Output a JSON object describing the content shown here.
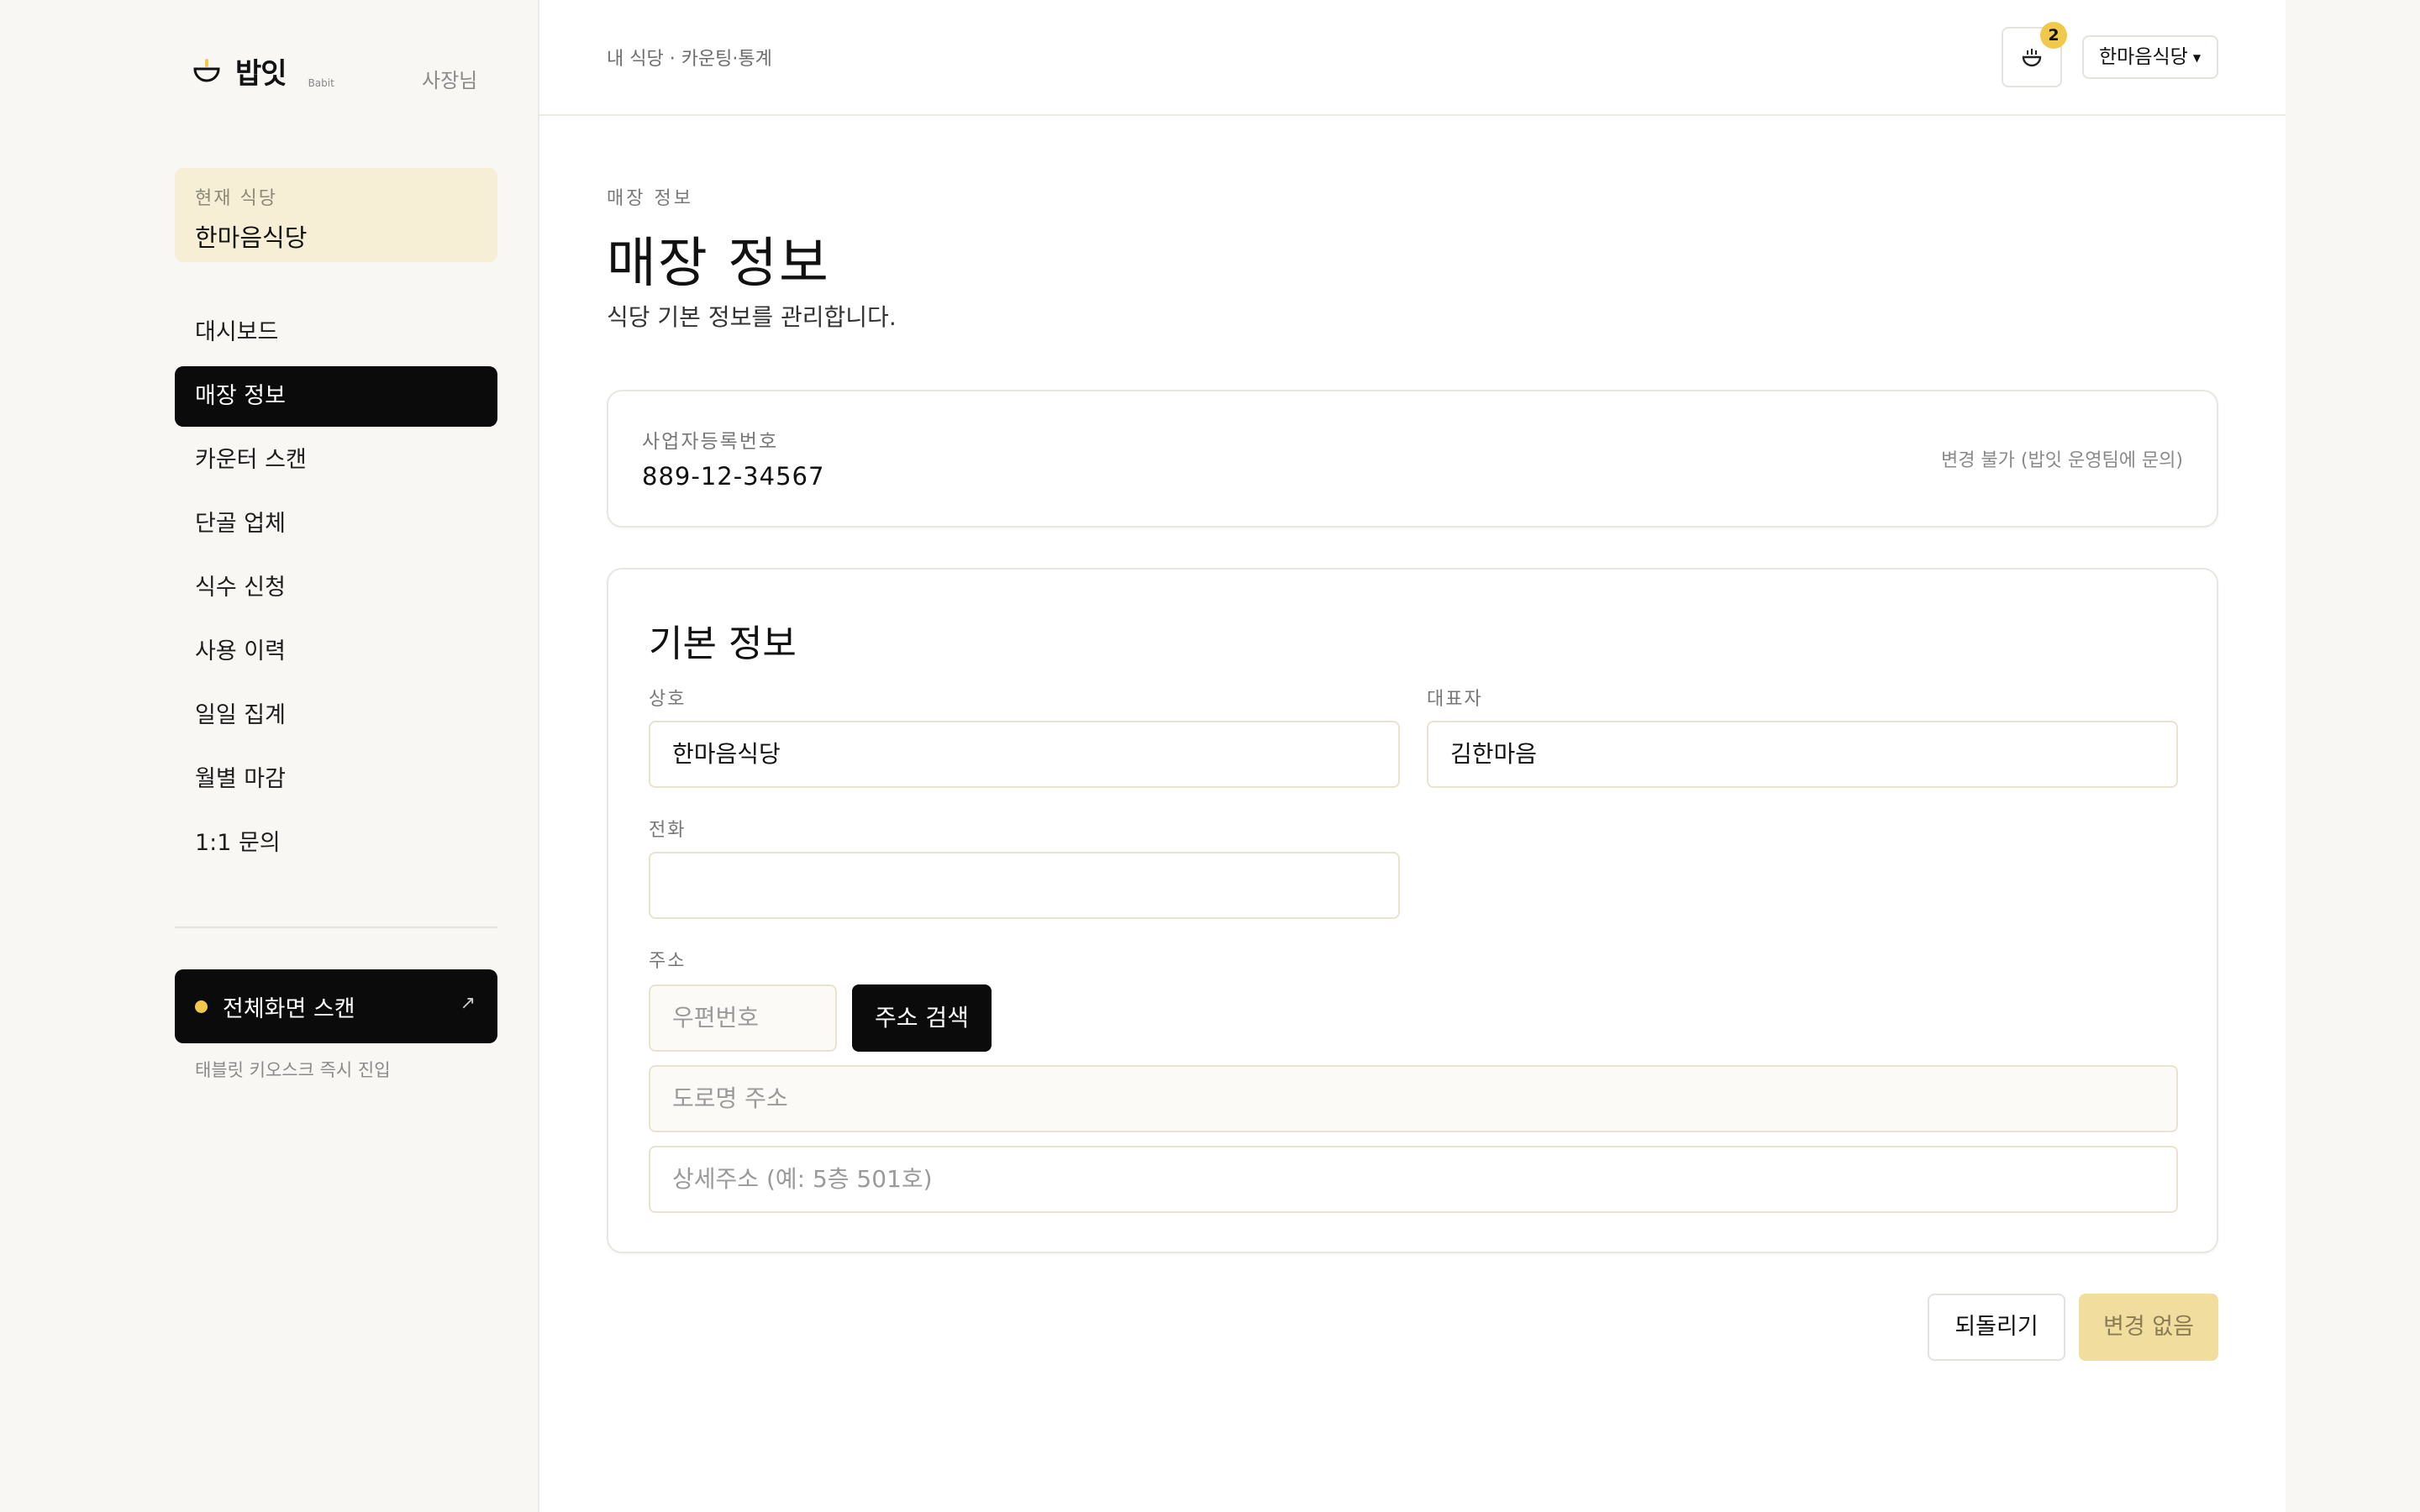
{
  "brand": {
    "name": "밥잇",
    "sub": "Babit",
    "role": "사장님"
  },
  "current_store": {
    "label": "현재 식당",
    "name": "한마음식당"
  },
  "nav": {
    "items": [
      {
        "label": "대시보드"
      },
      {
        "label": "매장 정보"
      },
      {
        "label": "카운터 스캔"
      },
      {
        "label": "단골 업체"
      },
      {
        "label": "식수 신청"
      },
      {
        "label": "사용 이력"
      },
      {
        "label": "일일 집계"
      },
      {
        "label": "월별 마감"
      },
      {
        "label": "1:1 문의"
      }
    ],
    "active_index": 1
  },
  "kiosk": {
    "label": "전체화면 스캔",
    "arrow": "↗",
    "note": "태블릿 키오스크 즉시 진입"
  },
  "topbar": {
    "breadcrumb": "내 식당 · 카운팅·통계",
    "notification_count": "2",
    "store_select": "한마음식당"
  },
  "page": {
    "eyebrow": "매장 정보",
    "title": "매장 정보",
    "description": "식당 기본 정보를 관리합니다."
  },
  "business": {
    "label": "사업자등록번호",
    "value": "889-12-34567",
    "note": "변경 불가 (밥잇 운영팀에 문의)"
  },
  "basic_info": {
    "title": "기본 정보",
    "name_label": "상호",
    "name_value": "한마음식당",
    "owner_label": "대표자",
    "owner_value": "김한마음",
    "phone_label": "전화",
    "phone_value": "",
    "address_label": "주소",
    "zip_placeholder": "우편번호",
    "search_label": "주소 검색",
    "road_placeholder": "도로명 주소",
    "detail_placeholder": "상세주소 (예: 5층 501호)"
  },
  "actions": {
    "revert": "되돌리기",
    "save": "변경 없음"
  },
  "colors": {
    "accent": "#f0c94a",
    "dark": "#0b0b0b",
    "highlight_bg": "#f6efd6",
    "disabled_save": "#f1dd9d"
  }
}
